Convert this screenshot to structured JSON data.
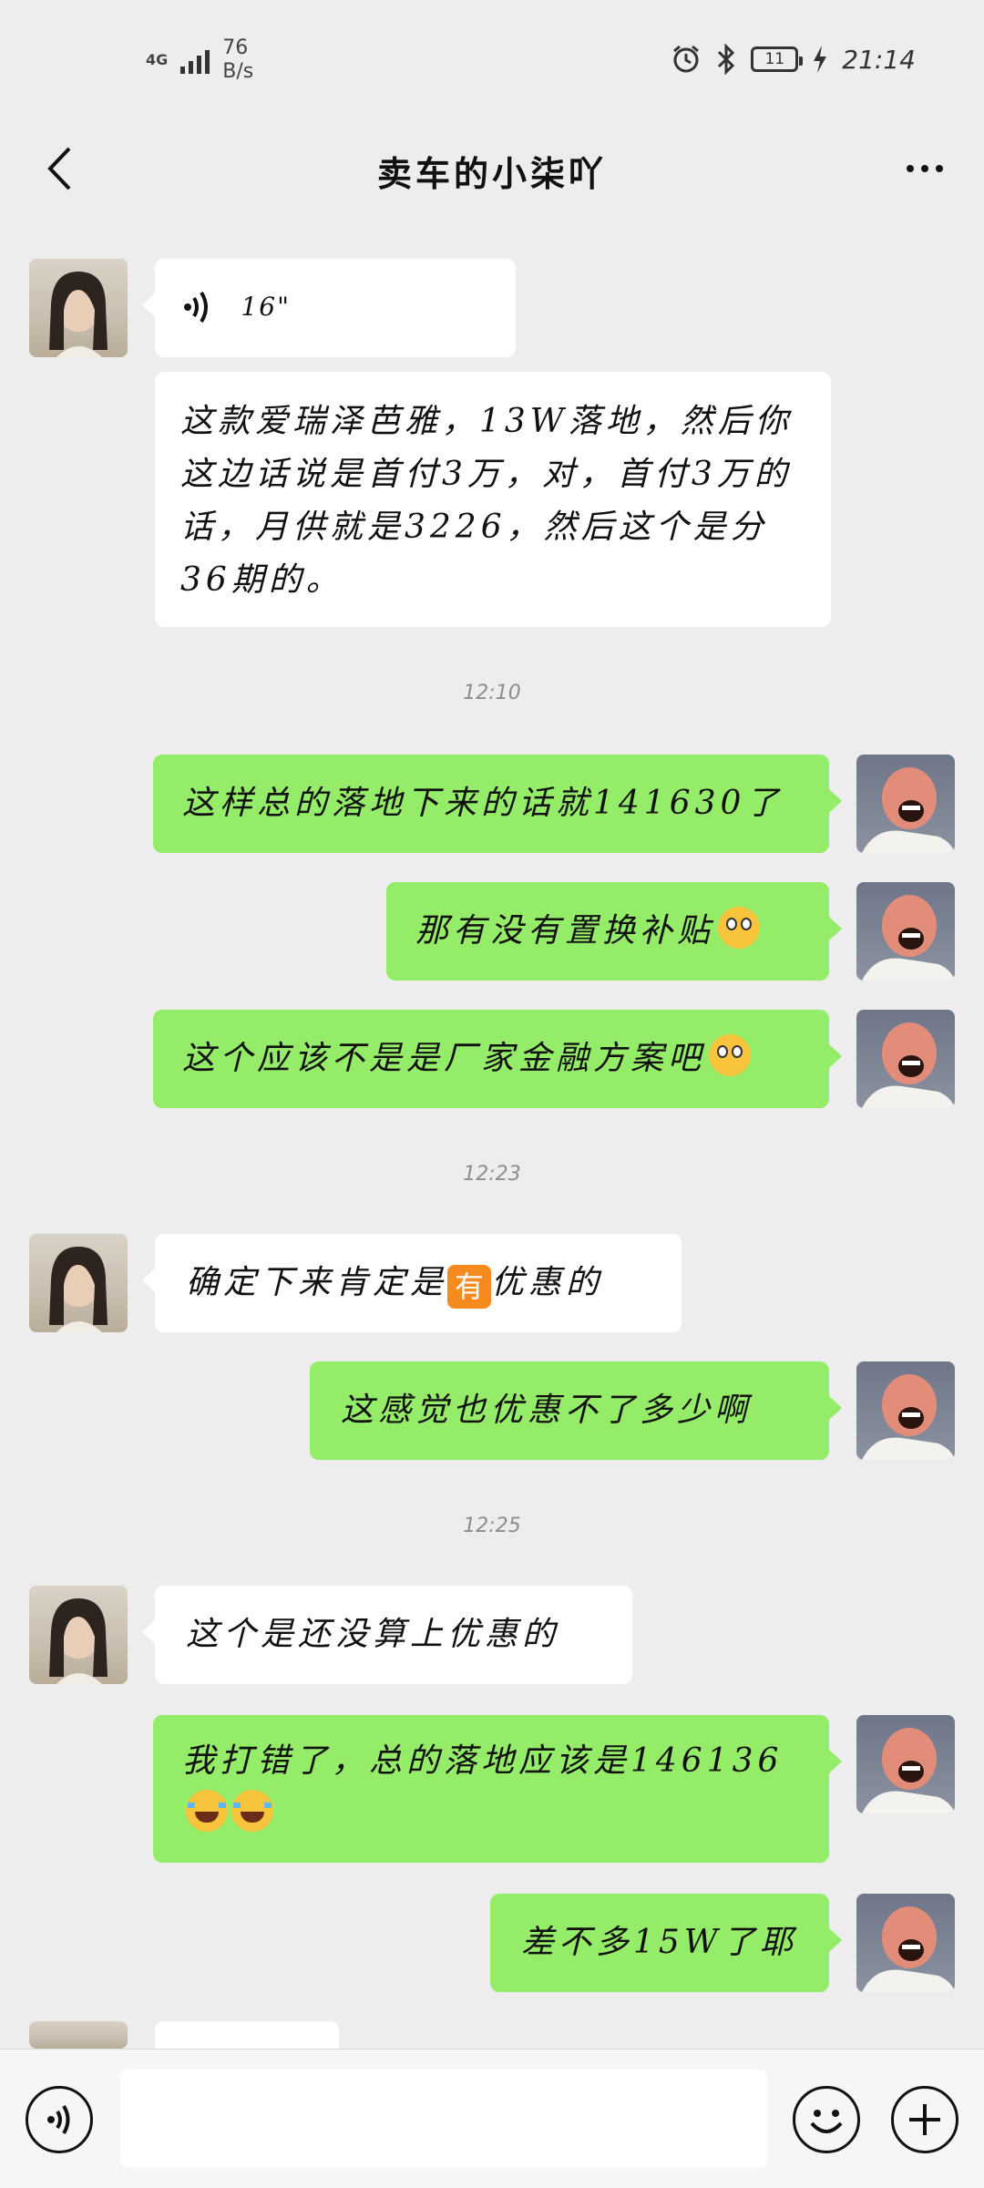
{
  "status_bar": {
    "network": "4G",
    "speed_value": "76",
    "speed_unit": "B/s",
    "battery": "11",
    "time": "21:14"
  },
  "header": {
    "title": "卖车的小柒吖",
    "back_icon": "chevron-left-icon",
    "more_icon": "more-dots-icon"
  },
  "messages": [
    {
      "side": "left",
      "type": "voice",
      "duration": "16\""
    },
    {
      "side": "left",
      "type": "text",
      "text": "这款爱瑞泽芭雅，13W落地，然后你这边话说是首付3万，对，首付3万的话，月供就是3226，然后这个是分36期的。"
    },
    {
      "type": "timestamp",
      "text": "12:10"
    },
    {
      "side": "right",
      "type": "text",
      "text": "这样总的落地下来的话就141630了"
    },
    {
      "side": "right",
      "type": "text",
      "text": "那有没有置换补贴",
      "emoji": "flushed-face-emoji"
    },
    {
      "side": "right",
      "type": "text",
      "text": "这个应该不是是厂家金融方案吧",
      "emoji": "flushed-face-emoji"
    },
    {
      "type": "timestamp",
      "text": "12:23"
    },
    {
      "side": "left",
      "type": "text",
      "text_before": "确定下来肯定是",
      "badge": "有",
      "text_after": "优惠的"
    },
    {
      "side": "right",
      "type": "text",
      "text": "这感觉也优惠不了多少啊"
    },
    {
      "type": "timestamp",
      "text": "12:25"
    },
    {
      "side": "left",
      "type": "text",
      "text": "这个是还没算上优惠的"
    },
    {
      "side": "right",
      "type": "text",
      "text": "我打错了，总的落地应该是146136",
      "emoji": "tears-of-joy-emoji"
    },
    {
      "side": "right",
      "type": "text",
      "text": "差不多15W了耶"
    }
  ],
  "input_bar": {
    "value": "",
    "voice_icon": "voice-icon",
    "emoji_icon": "smiley-icon",
    "plus_icon": "plus-icon"
  }
}
